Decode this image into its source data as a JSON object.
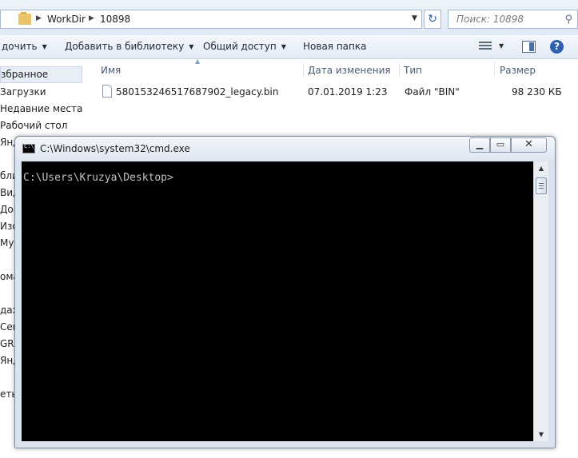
{
  "explorer": {
    "breadcrumb": [
      "WorkDir",
      "10898"
    ],
    "search_placeholder": "Поиск: 10898",
    "toolbar": {
      "organize": "дочить",
      "add_library": "Добавить в библиотеку",
      "share": "Общий доступ",
      "new_folder": "Новая папка"
    },
    "nav": [
      "збранное",
      "Загрузки",
      "Недавние места",
      "Рабочий стол",
      "Янд",
      "бли",
      "Вид",
      "Док",
      "Изо",
      "Муз",
      "ома",
      "дах",
      "Сем",
      "GRM",
      "Янд",
      "еть"
    ],
    "columns": {
      "name": "Имя",
      "date": "Дата изменения",
      "type": "Тип",
      "size": "Размер"
    },
    "files": [
      {
        "name": "580153246517687902_legacy.bin",
        "date": "07.01.2019 1:23",
        "type": "Файл \"BIN\"",
        "size": "98 230 КБ"
      }
    ]
  },
  "cmd": {
    "title": "C:\\Windows\\system32\\cmd.exe",
    "prompt": "C:\\Users\\Kruzya\\Desktop>"
  },
  "icons": [
    "folder-icon",
    "refresh-icon",
    "search-icon",
    "view-icon",
    "preview-pane-icon",
    "help-icon",
    "file-icon",
    "cmd-app-icon",
    "minimize-icon",
    "maximize-icon",
    "close-icon"
  ]
}
